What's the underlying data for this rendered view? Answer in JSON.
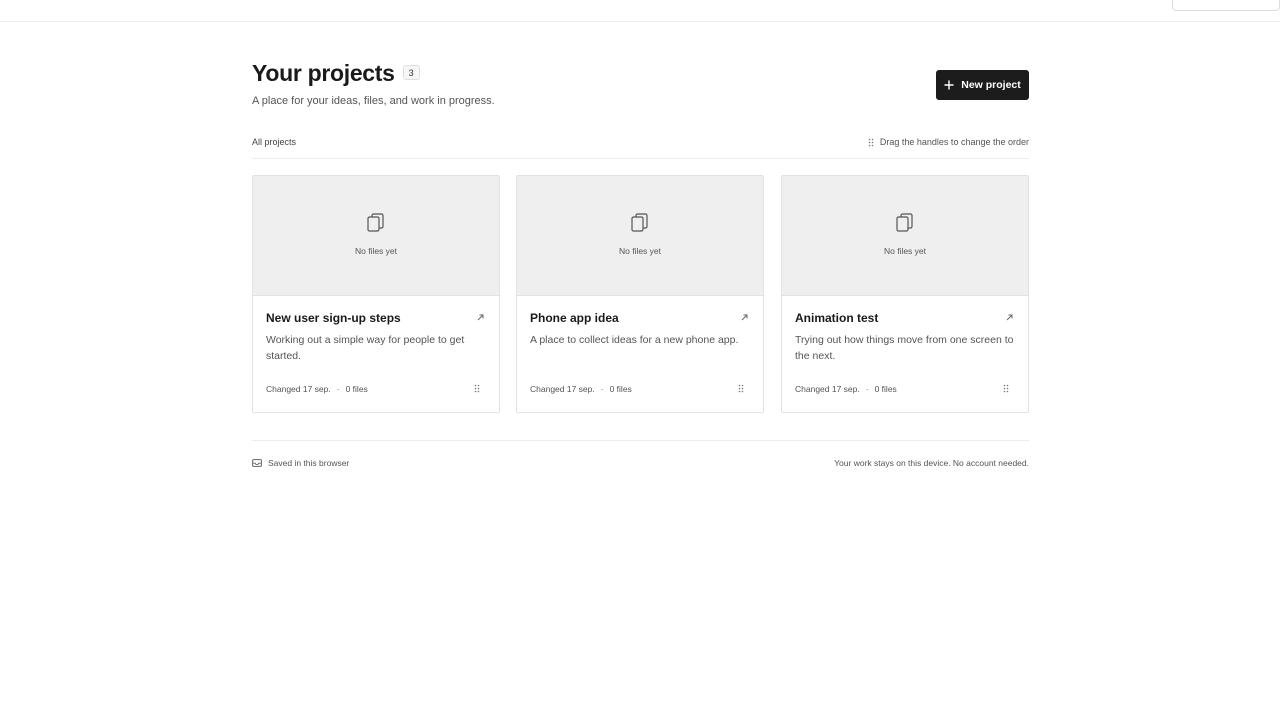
{
  "header": {
    "title": "Your projects",
    "count": "3",
    "subtitle": "A place for your ideas, files, and work in progress.",
    "new_project_label": "New project"
  },
  "toolbar": {
    "filter_label": "All projects",
    "drag_hint": "Drag the handles to change the order"
  },
  "projects": [
    {
      "empty_label": "No files yet",
      "title": "New user sign-up steps",
      "description": "Working out a simple way for people to get started.",
      "changed": "Changed 17 sep.",
      "files": "0 files"
    },
    {
      "empty_label": "No files yet",
      "title": "Phone app idea",
      "description": "A place to collect ideas for a new phone app.",
      "changed": "Changed 17 sep.",
      "files": "0 files"
    },
    {
      "empty_label": "No files yet",
      "title": "Animation test",
      "description": "Trying out how things move from one screen to the next.",
      "changed": "Changed 17 sep.",
      "files": "0 files"
    }
  ],
  "footer": {
    "saved_label": "Saved in this browser",
    "privacy_note": "Your work stays on this device. No account needed."
  },
  "icons": {
    "new_project": "plus-icon",
    "drag_hint": "drag-handle-icon",
    "preview": "files-icon",
    "open": "open-arrow-icon",
    "reorder": "drag-handle-icon",
    "saved": "storage-icon"
  },
  "colors": {
    "primary_button": "#1c1c1c",
    "preview_bg": "#efefef",
    "border": "#e2e2e2"
  }
}
